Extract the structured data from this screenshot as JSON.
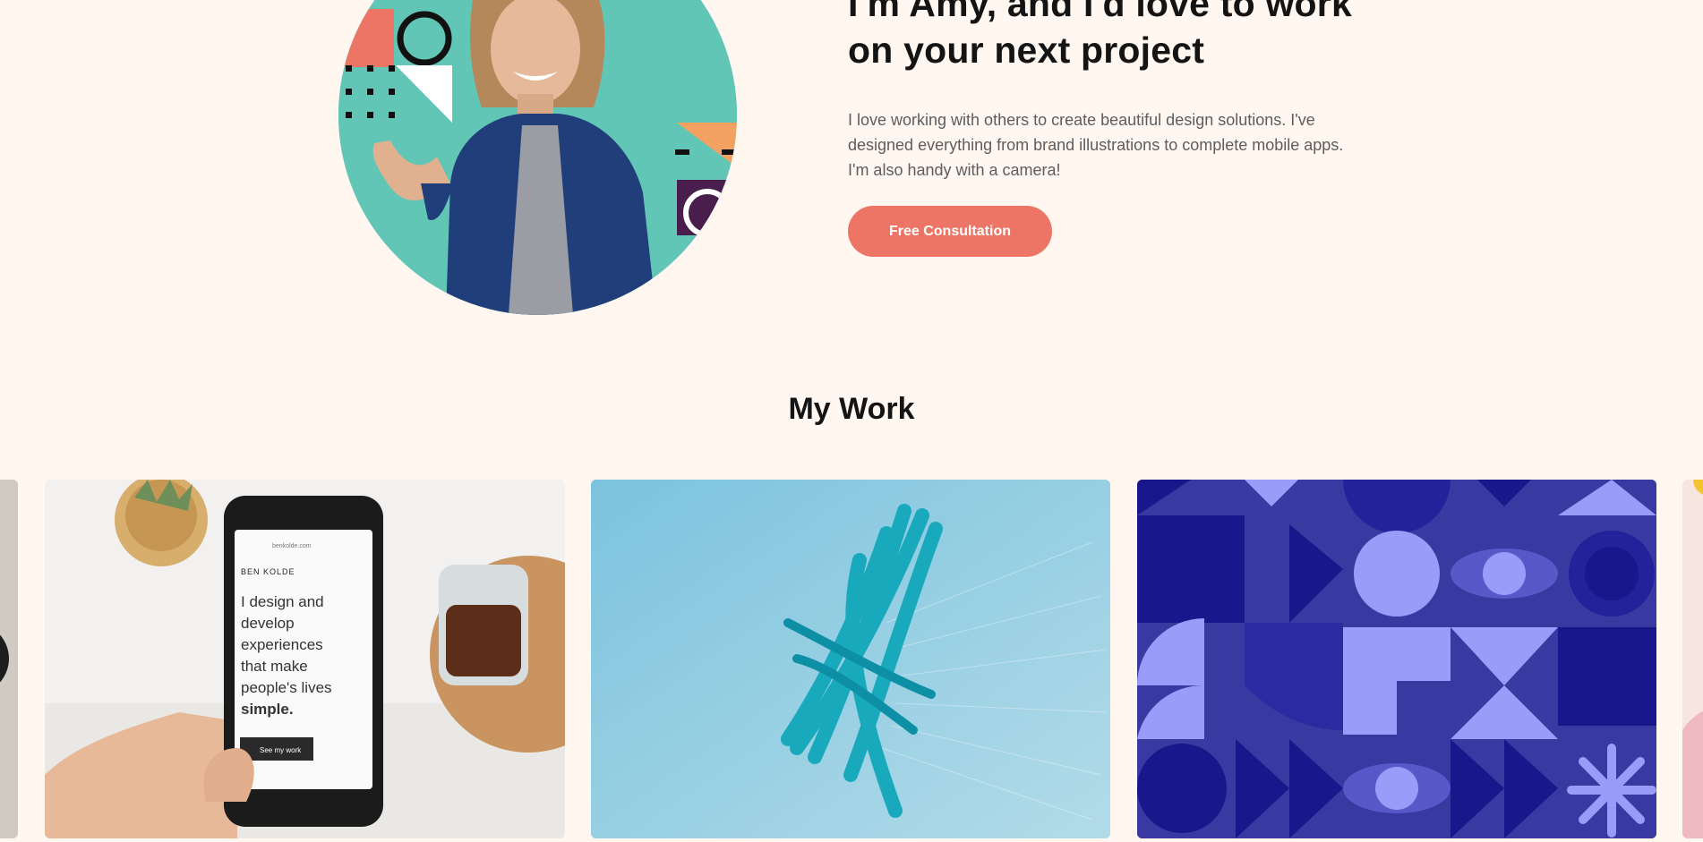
{
  "hero": {
    "heading_line1": "I'm Amy, and I'd love to work",
    "heading_line2": "on your next project",
    "description": "I love working with others to create beautiful design solutions. I've designed everything from brand illustrations to complete mobile apps. I'm also handy with a camera!",
    "cta_label": "Free Consultation",
    "portrait_alt": "Smiling woman in a denim shirt against a teal background with geometric shapes"
  },
  "work": {
    "title": "My Work",
    "items": [
      {
        "alt": "Partial view of a dark circular object"
      },
      {
        "alt": "Hand holding a phone with text about design",
        "phone_brand": "BEN KOLDE",
        "phone_url": "benkolde.com",
        "phone_text_lines": [
          "I design and",
          "develop",
          "experiences",
          "that make",
          "people's lives"
        ],
        "phone_text_bold": "simple.",
        "phone_button": "See my work"
      },
      {
        "alt": "Teal abstract ribbons on a light blue background"
      },
      {
        "alt": "Geometric purple and blue pattern with eyes and shapes"
      },
      {
        "alt": "Partial view of a pink illustration"
      }
    ]
  },
  "colors": {
    "background": "#fff7f0",
    "accent": "#ec7565",
    "heading": "#141414",
    "body_text": "#5d5d5d"
  }
}
